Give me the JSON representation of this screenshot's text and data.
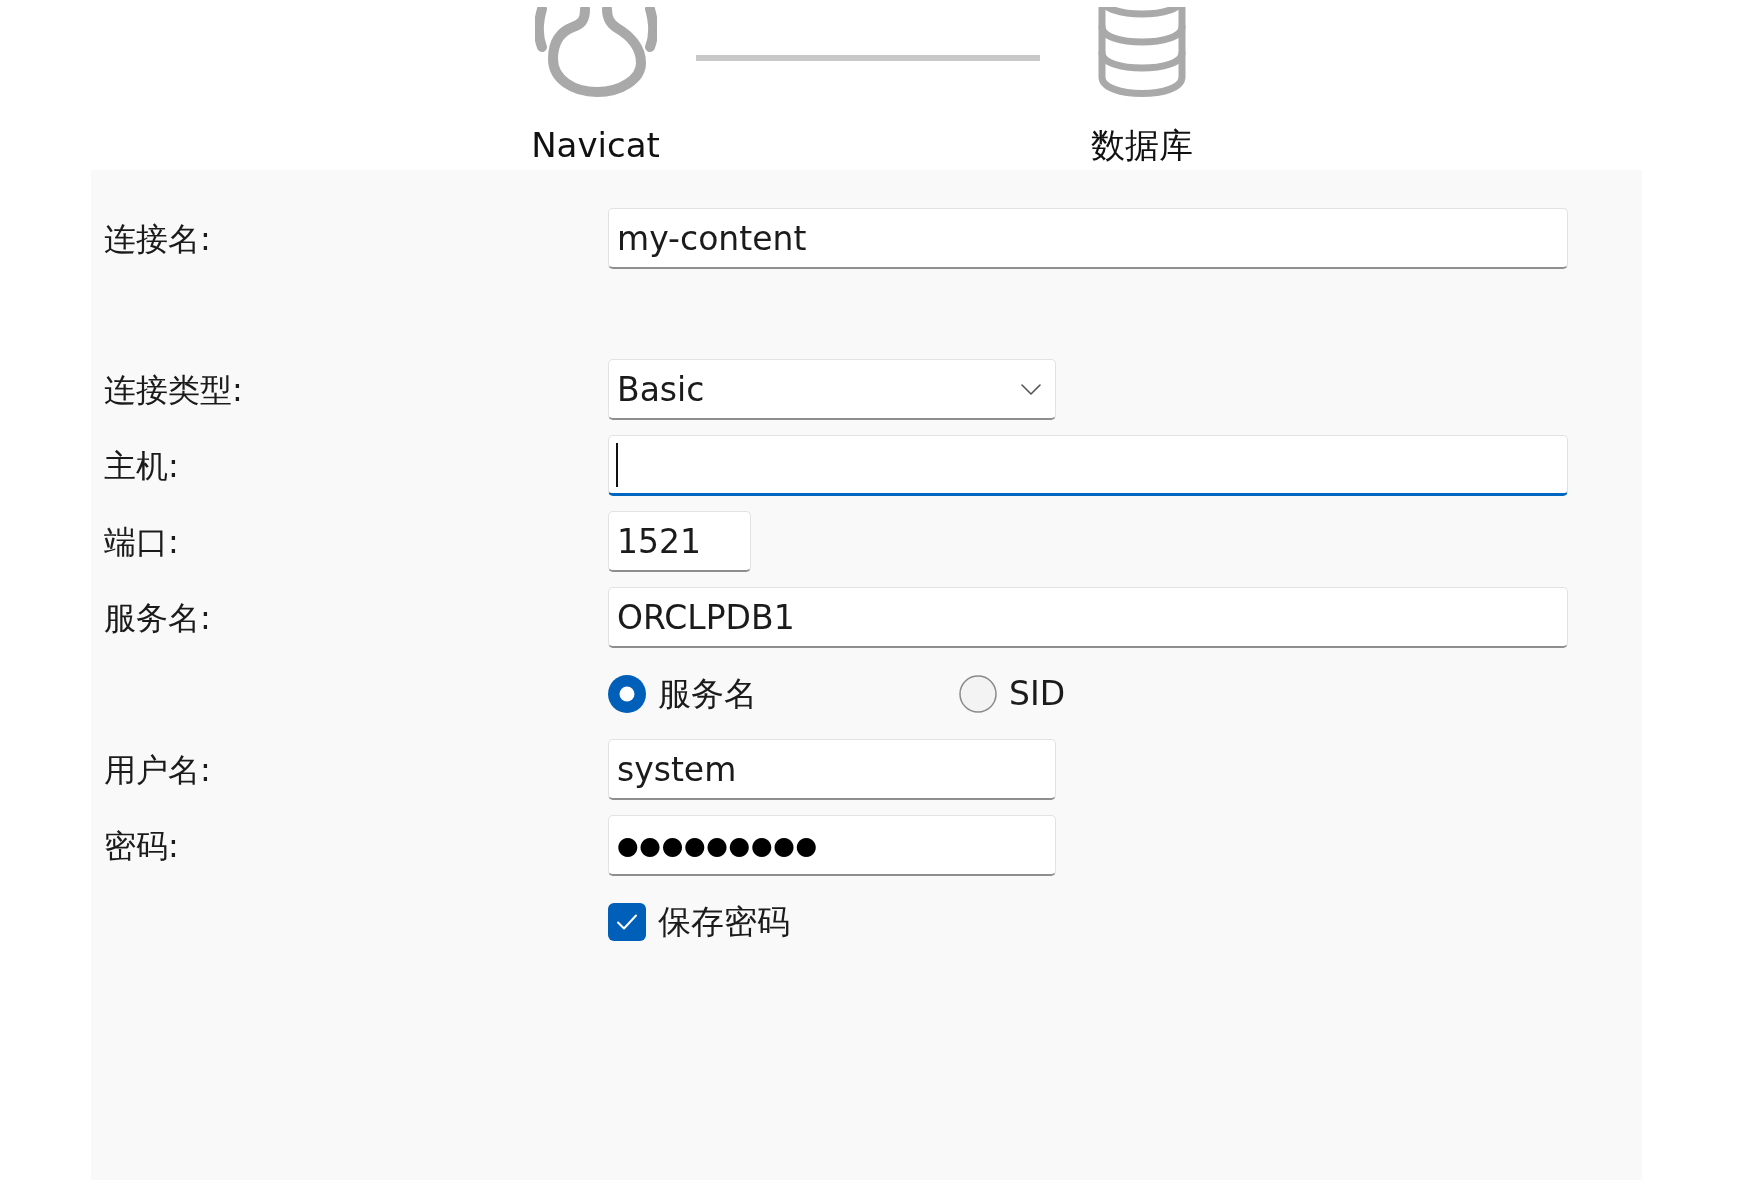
{
  "connection_diagram": {
    "source": {
      "label": "Navicat"
    },
    "target": {
      "label": "数据库"
    }
  },
  "form": {
    "connection_name": {
      "label": "连接名:",
      "value": "my-content"
    },
    "connection_type": {
      "label": "连接类型:",
      "value": "Basic"
    },
    "host": {
      "label": "主机:",
      "focused": true
    },
    "port": {
      "label": "端口:",
      "value": "1521"
    },
    "service_name": {
      "label": "服务名:",
      "value": "ORCLPDB1"
    },
    "service_name_type": [
      {
        "label": "服务名",
        "selected": true
      },
      {
        "label": "SID",
        "selected": false
      }
    ],
    "username": {
      "label": "用户名:",
      "value": "system"
    },
    "password": {
      "label": "密码:",
      "value": "●●●●●●●●●"
    },
    "save_password": {
      "label": "保存密码",
      "checked": true
    }
  }
}
